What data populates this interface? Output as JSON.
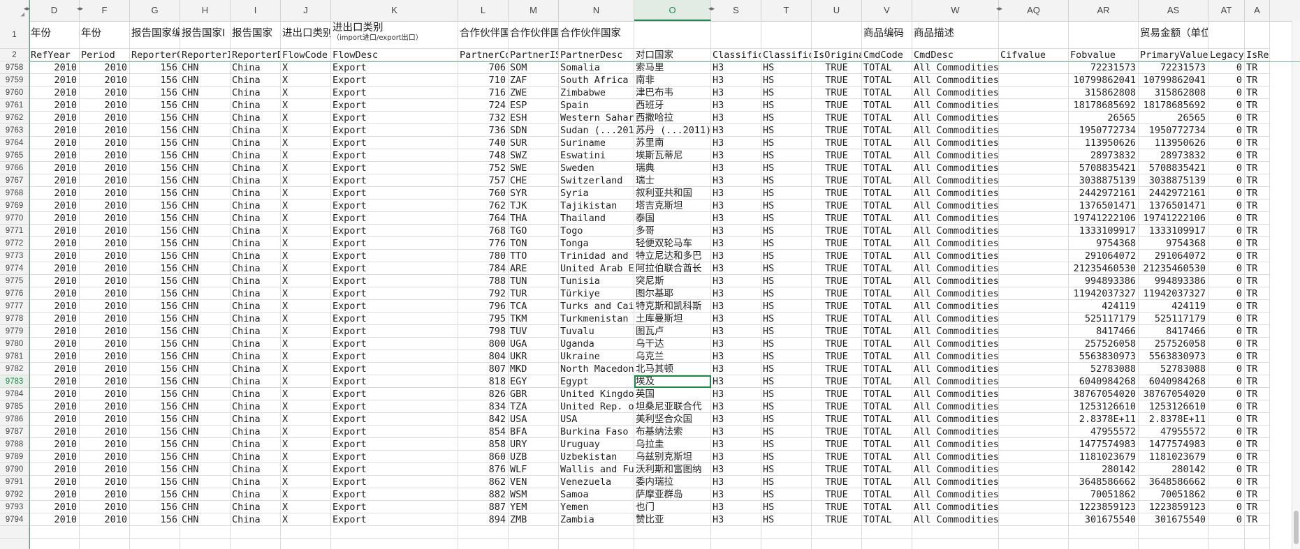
{
  "columns": [
    {
      "letter": "D",
      "width": 72
    },
    {
      "letter": "F",
      "width": 72
    },
    {
      "letter": "G",
      "width": 72
    },
    {
      "letter": "H",
      "width": 72
    },
    {
      "letter": "I",
      "width": 72
    },
    {
      "letter": "J",
      "width": 72
    },
    {
      "letter": "K",
      "width": 182
    },
    {
      "letter": "L",
      "width": 72
    },
    {
      "letter": "M",
      "width": 72
    },
    {
      "letter": "N",
      "width": 108
    },
    {
      "letter": "O",
      "width": 110
    },
    {
      "letter": "S",
      "width": 72
    },
    {
      "letter": "T",
      "width": 72
    },
    {
      "letter": "U",
      "width": 72
    },
    {
      "letter": "V",
      "width": 72
    },
    {
      "letter": "W",
      "width": 124
    },
    {
      "letter": "AQ",
      "width": 100
    },
    {
      "letter": "AR",
      "width": 100
    },
    {
      "letter": "AS",
      "width": 100
    },
    {
      "letter": "AT",
      "width": 52
    },
    {
      "letter": "A",
      "width": 36
    }
  ],
  "selected_column": "O",
  "selected_row": "9783",
  "row1": [
    "年份",
    "年份",
    "报告国家编",
    "报告国家I",
    "报告国家",
    "进出口类别",
    "进出口类别",
    "合作伙伴国",
    "合作伙伴国",
    "合作伙伴国家",
    "",
    "",
    "",
    "",
    "商品编码",
    "商品描述",
    "",
    "",
    "贸易金额（单位：美元）",
    "",
    ""
  ],
  "row1_sub_k": "（import进口/export出口）",
  "row2": [
    "RefYear",
    "Period",
    "ReporterC",
    "ReporterI",
    "ReporterD",
    "FlowCode",
    "FlowDesc",
    "PartnerCo",
    "PartnerIS",
    "PartnerDesc",
    "对口国家",
    "Classific",
    "Classific",
    "IsOriginal",
    "CmdCode",
    "CmdDesc",
    "Cifvalue",
    "Fobvalue",
    "PrimaryValue",
    "LegacyEst",
    "IsRep"
  ],
  "rows": [
    {
      "n": "9758",
      "code": "706",
      "iso": "SOM",
      "desc": "Somalia",
      "cn": "索马里",
      "fob": "72231573",
      "pv": "72231573"
    },
    {
      "n": "9759",
      "code": "710",
      "iso": "ZAF",
      "desc": "South Africa",
      "cn": "南非",
      "fob": "10799862041",
      "pv": "10799862041"
    },
    {
      "n": "9760",
      "code": "716",
      "iso": "ZWE",
      "desc": "Zimbabwe",
      "cn": "津巴布韦",
      "fob": "315862808",
      "pv": "315862808"
    },
    {
      "n": "9761",
      "code": "724",
      "iso": "ESP",
      "desc": "Spain",
      "cn": "西班牙",
      "fob": "18178685692",
      "pv": "18178685692"
    },
    {
      "n": "9762",
      "code": "732",
      "iso": "ESH",
      "desc": "Western Sahar",
      "cn": "西撒哈拉",
      "fob": "26565",
      "pv": "26565"
    },
    {
      "n": "9763",
      "code": "736",
      "iso": "SDN",
      "desc": "Sudan (...201",
      "cn": "苏丹 (...2011)",
      "fob": "1950772734",
      "pv": "1950772734"
    },
    {
      "n": "9764",
      "code": "740",
      "iso": "SUR",
      "desc": "Suriname",
      "cn": "苏里南",
      "fob": "113950626",
      "pv": "113950626"
    },
    {
      "n": "9765",
      "code": "748",
      "iso": "SWZ",
      "desc": "Eswatini",
      "cn": "埃斯瓦蒂尼",
      "fob": "28973832",
      "pv": "28973832"
    },
    {
      "n": "9766",
      "code": "752",
      "iso": "SWE",
      "desc": "Sweden",
      "cn": "瑞典",
      "fob": "5708835421",
      "pv": "5708835421"
    },
    {
      "n": "9767",
      "code": "757",
      "iso": "CHE",
      "desc": "Switzerland",
      "cn": "瑞士",
      "fob": "3038875139",
      "pv": "3038875139"
    },
    {
      "n": "9768",
      "code": "760",
      "iso": "SYR",
      "desc": "Syria",
      "cn": "叙利亚共和国",
      "fob": "2442972161",
      "pv": "2442972161"
    },
    {
      "n": "9769",
      "code": "762",
      "iso": "TJK",
      "desc": "Tajikistan",
      "cn": "塔吉克斯坦",
      "fob": "1376501471",
      "pv": "1376501471"
    },
    {
      "n": "9770",
      "code": "764",
      "iso": "THA",
      "desc": "Thailand",
      "cn": "泰国",
      "fob": "19741222106",
      "pv": "19741222106"
    },
    {
      "n": "9771",
      "code": "768",
      "iso": "TGO",
      "desc": "Togo",
      "cn": "多哥",
      "fob": "1333109917",
      "pv": "1333109917"
    },
    {
      "n": "9772",
      "code": "776",
      "iso": "TON",
      "desc": "Tonga",
      "cn": "轻便双轮马车",
      "fob": "9754368",
      "pv": "9754368"
    },
    {
      "n": "9773",
      "code": "780",
      "iso": "TTO",
      "desc": "Trinidad and",
      "cn": "特立尼达和多巴",
      "fob": "291064072",
      "pv": "291064072"
    },
    {
      "n": "9774",
      "code": "784",
      "iso": "ARE",
      "desc": "United Arab E",
      "cn": "阿拉伯联合酋长",
      "fob": "21235460530",
      "pv": "21235460530"
    },
    {
      "n": "9775",
      "code": "788",
      "iso": "TUN",
      "desc": "Tunisia",
      "cn": "突尼斯",
      "fob": "994893386",
      "pv": "994893386"
    },
    {
      "n": "9776",
      "code": "792",
      "iso": "TUR",
      "desc": "Türkiye",
      "cn": "图尔基耶",
      "fob": "11942037327",
      "pv": "11942037327"
    },
    {
      "n": "9777",
      "code": "796",
      "iso": "TCA",
      "desc": "Turks and Cai",
      "cn": "特克斯和凯科斯",
      "fob": "424119",
      "pv": "424119"
    },
    {
      "n": "9778",
      "code": "795",
      "iso": "TKM",
      "desc": "Turkmenistan",
      "cn": "土库曼斯坦",
      "fob": "525117179",
      "pv": "525117179"
    },
    {
      "n": "9779",
      "code": "798",
      "iso": "TUV",
      "desc": "Tuvalu",
      "cn": "图瓦卢",
      "fob": "8417466",
      "pv": "8417466"
    },
    {
      "n": "9780",
      "code": "800",
      "iso": "UGA",
      "desc": "Uganda",
      "cn": "乌干达",
      "fob": "257526058",
      "pv": "257526058"
    },
    {
      "n": "9781",
      "code": "804",
      "iso": "UKR",
      "desc": "Ukraine",
      "cn": "乌克兰",
      "fob": "5563830973",
      "pv": "5563830973"
    },
    {
      "n": "9782",
      "code": "807",
      "iso": "MKD",
      "desc": "North Macedon",
      "cn": "北马其顿",
      "fob": "52783088",
      "pv": "52783088"
    },
    {
      "n": "9783",
      "code": "818",
      "iso": "EGY",
      "desc": "Egypt",
      "cn": "埃及",
      "fob": "6040984268",
      "pv": "6040984268"
    },
    {
      "n": "9784",
      "code": "826",
      "iso": "GBR",
      "desc": "United Kingdo",
      "cn": "英国",
      "fob": "38767054020",
      "pv": "38767054020"
    },
    {
      "n": "9785",
      "code": "834",
      "iso": "TZA",
      "desc": "United Rep. o",
      "cn": "坦桑尼亚联合代",
      "fob": "1253126610",
      "pv": "1253126610"
    },
    {
      "n": "9786",
      "code": "842",
      "iso": "USA",
      "desc": "USA",
      "cn": "美利坚合众国",
      "fob": "2.8378E+11",
      "pv": "2.8378E+11"
    },
    {
      "n": "9787",
      "code": "854",
      "iso": "BFA",
      "desc": "Burkina Faso",
      "cn": "布基纳法索",
      "fob": "47955572",
      "pv": "47955572"
    },
    {
      "n": "9788",
      "code": "858",
      "iso": "URY",
      "desc": "Uruguay",
      "cn": "乌拉圭",
      "fob": "1477574983",
      "pv": "1477574983"
    },
    {
      "n": "9789",
      "code": "860",
      "iso": "UZB",
      "desc": "Uzbekistan",
      "cn": "乌兹别克斯坦",
      "fob": "1181023679",
      "pv": "1181023679"
    },
    {
      "n": "9790",
      "code": "876",
      "iso": "WLF",
      "desc": "Wallis and Fu",
      "cn": "沃利斯和富图纳",
      "fob": "280142",
      "pv": "280142"
    },
    {
      "n": "9791",
      "code": "862",
      "iso": "VEN",
      "desc": "Venezuela",
      "cn": "委内瑞拉",
      "fob": "3648586662",
      "pv": "3648586662"
    },
    {
      "n": "9792",
      "code": "882",
      "iso": "WSM",
      "desc": "Samoa",
      "cn": "萨摩亚群岛",
      "fob": "70051862",
      "pv": "70051862"
    },
    {
      "n": "9793",
      "code": "887",
      "iso": "YEM",
      "desc": "Yemen",
      "cn": "也门",
      "fob": "1223859123",
      "pv": "1223859123"
    },
    {
      "n": "9794",
      "code": "894",
      "iso": "ZMB",
      "desc": "Zambia",
      "cn": "赞比亚",
      "fob": "301675540",
      "pv": "301675540"
    }
  ],
  "common": {
    "year": "2010",
    "period": "2010",
    "reporter_code": "156",
    "reporter_iso": "CHN",
    "reporter_desc": "China",
    "flow_code": "X",
    "flow_desc": "Export",
    "class1": "H3",
    "class2": "HS",
    "is_original": "TRUE",
    "cmd_code": "TOTAL",
    "cmd_desc": "All Commodities",
    "legacy": "0",
    "is_rep": "TR"
  },
  "colors": {
    "accent": "#1f8a4c",
    "grid": "#dcdcdc",
    "header_bg": "#f3f3f3"
  }
}
